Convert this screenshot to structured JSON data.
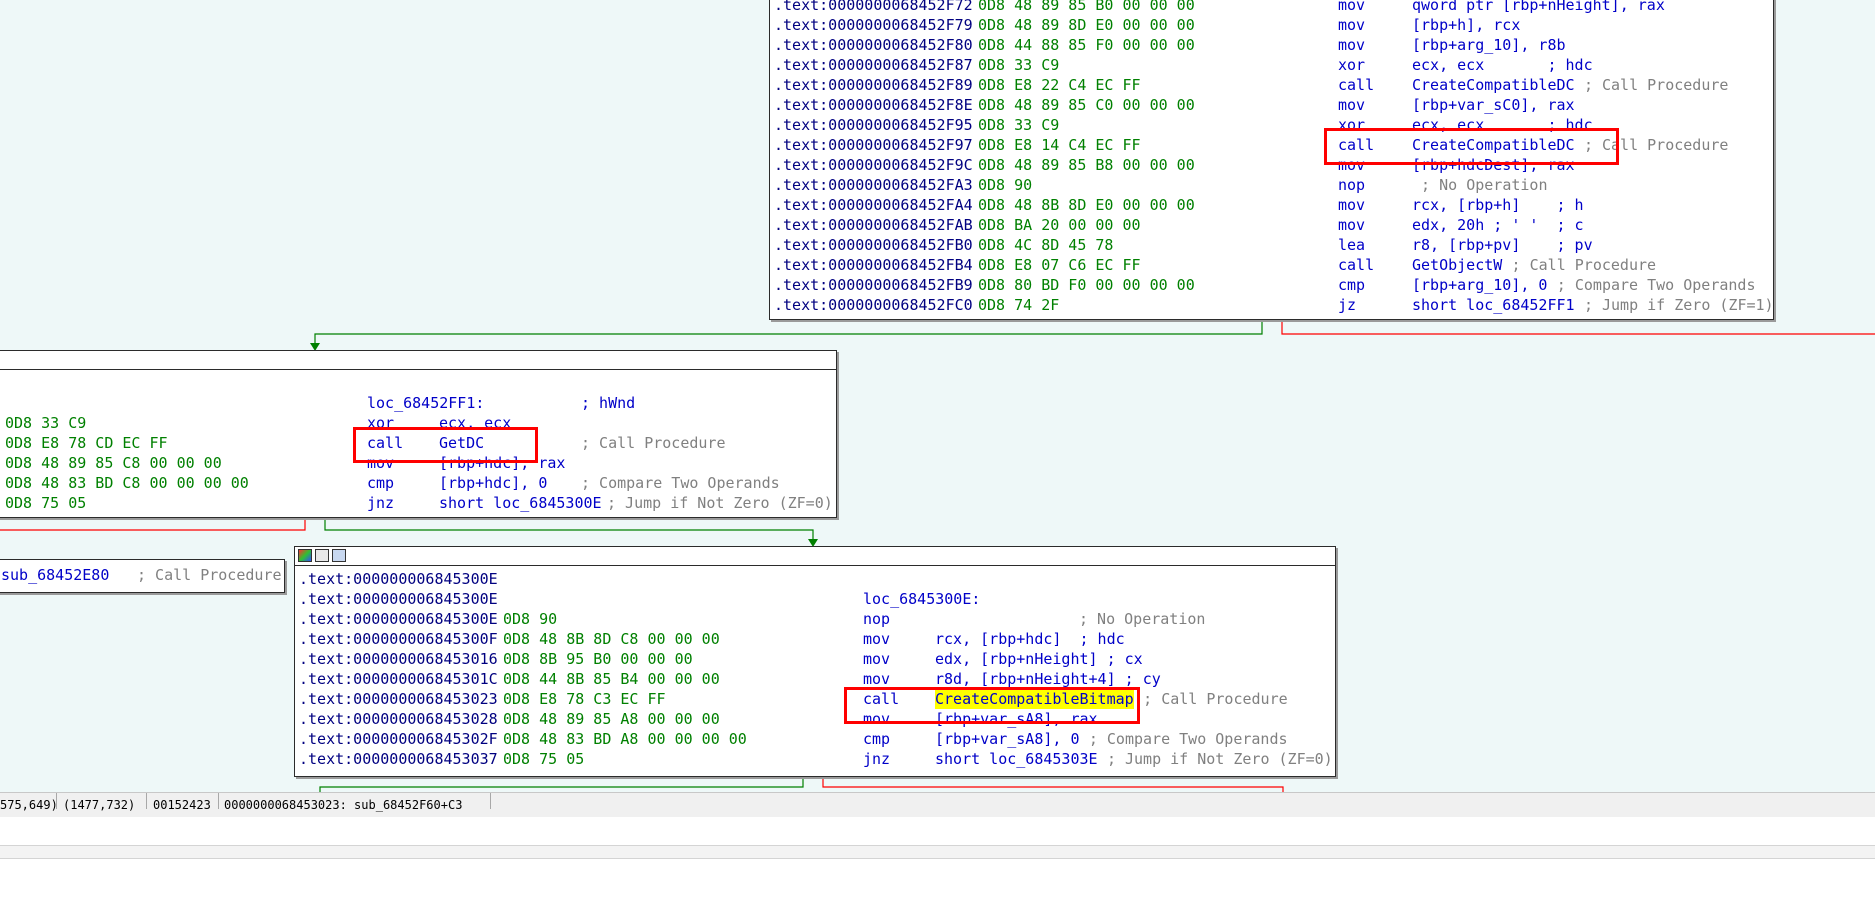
{
  "colors": {
    "accent_red": "#ff0000",
    "edge_green": "#008000",
    "edge_red": "#ff0000",
    "highlight": "#ffff00",
    "graph_bg": "#eef8f8"
  },
  "top_block": {
    "lines": [
      {
        "addr": ".text:0000000068452F72",
        "bytes": "0D8 48 89 85 B0 00 00 00",
        "mnem": "mov",
        "ops": "qword ptr [rbp+nHeight], rax",
        "cmt": ""
      },
      {
        "addr": ".text:0000000068452F79",
        "bytes": "0D8 48 89 8D E0 00 00 00",
        "mnem": "mov",
        "ops": "[rbp+h], rcx",
        "cmt": ""
      },
      {
        "addr": ".text:0000000068452F80",
        "bytes": "0D8 44 88 85 F0 00 00 00",
        "mnem": "mov",
        "ops": "[rbp+arg_10], r8b",
        "cmt": ""
      },
      {
        "addr": ".text:0000000068452F87",
        "bytes": "0D8 33 C9",
        "mnem": "xor",
        "ops": "ecx, ecx       ; hdc",
        "cmt": ""
      },
      {
        "addr": ".text:0000000068452F89",
        "bytes": "0D8 E8 22 C4 EC FF",
        "mnem": "call",
        "ops": "CreateCompatibleDC",
        "cmt": "; Call Procedure"
      },
      {
        "addr": ".text:0000000068452F8E",
        "bytes": "0D8 48 89 85 C0 00 00 00",
        "mnem": "mov",
        "ops": "[rbp+var_sC0], rax",
        "cmt": ""
      },
      {
        "addr": ".text:0000000068452F95",
        "bytes": "0D8 33 C9",
        "mnem": "xor",
        "ops": "ecx, ecx       ; hdc",
        "cmt": ""
      },
      {
        "addr": ".text:0000000068452F97",
        "bytes": "0D8 E8 14 C4 EC FF",
        "mnem": "call",
        "ops": "CreateCompatibleDC",
        "cmt": "; Call Procedure"
      },
      {
        "addr": ".text:0000000068452F9C",
        "bytes": "0D8 48 89 85 B8 00 00 00",
        "mnem": "mov",
        "ops": "[rbp+hdcDest], rax",
        "cmt": ""
      },
      {
        "addr": ".text:0000000068452FA3",
        "bytes": "0D8 90",
        "mnem": "nop",
        "ops": "",
        "cmt": "; No Operation"
      },
      {
        "addr": ".text:0000000068452FA4",
        "bytes": "0D8 48 8B 8D E0 00 00 00",
        "mnem": "mov",
        "ops": "rcx, [rbp+h]    ; h",
        "cmt": ""
      },
      {
        "addr": ".text:0000000068452FAB",
        "bytes": "0D8 BA 20 00 00 00",
        "mnem": "mov",
        "ops": "edx, 20h ; ' '  ; c",
        "cmt": ""
      },
      {
        "addr": ".text:0000000068452FB0",
        "bytes": "0D8 4C 8D 45 78",
        "mnem": "lea",
        "ops": "r8, [rbp+pv]    ; pv",
        "cmt": ""
      },
      {
        "addr": ".text:0000000068452FB4",
        "bytes": "0D8 E8 07 C6 EC FF",
        "mnem": "call",
        "ops": "GetObjectW",
        "cmt": "; Call Procedure"
      },
      {
        "addr": ".text:0000000068452FB9",
        "bytes": "0D8 80 BD F0 00 00 00 00",
        "mnem": "cmp",
        "ops": "[rbp+arg_10], 0",
        "cmt": "; Compare Two Operands"
      },
      {
        "addr": ".text:0000000068452FC0",
        "bytes": "0D8 74 2F",
        "mnem": "jz",
        "ops": "short loc_68452FF1",
        "cmt": "; Jump if Zero (ZF=1)"
      }
    ]
  },
  "mid_block": {
    "label": "loc_68452FF1:",
    "label_cmt": "; hWnd",
    "lines": [
      {
        "bytes": "0D8 33 C9",
        "mnem": "xor",
        "ops": "ecx, ecx",
        "cmt": ""
      },
      {
        "bytes": "0D8 E8 78 CD EC FF",
        "mnem": "call",
        "ops": "GetDC",
        "cmt": "; Call Procedure"
      },
      {
        "bytes": "0D8 48 89 85 C8 00 00 00",
        "mnem": "mov",
        "ops": "[rbp+hdc], rax",
        "cmt": ""
      },
      {
        "bytes": "0D8 48 83 BD C8 00 00 00 00",
        "mnem": "cmp",
        "ops": "[rbp+hdc], 0",
        "cmt": "; Compare Two Operands"
      },
      {
        "bytes": "0D8 75 05",
        "mnem": "jnz",
        "ops": "short loc_6845300E",
        "cmt": "; Jump if Not Zero (ZF=0)"
      }
    ]
  },
  "left_block": {
    "ops": "sub_68452E80",
    "cmt": "; Call Procedure"
  },
  "bottom_block": {
    "lines": [
      {
        "addr": ".text:000000006845300E",
        "bytes": "",
        "mnem": "",
        "ops": "",
        "cmt": ""
      },
      {
        "addr": ".text:000000006845300E",
        "bytes": "",
        "mnem": "loc_6845300E:",
        "ops": "",
        "cmt": ""
      },
      {
        "addr": ".text:000000006845300E",
        "bytes": "0D8 90",
        "mnem": "nop",
        "ops": "",
        "cmt": "; No Operation"
      },
      {
        "addr": ".text:000000006845300F",
        "bytes": "0D8 48 8B 8D C8 00 00 00",
        "mnem": "mov",
        "ops": "rcx, [rbp+hdc]  ; hdc",
        "cmt": ""
      },
      {
        "addr": ".text:0000000068453016",
        "bytes": "0D8 8B 95 B0 00 00 00",
        "mnem": "mov",
        "ops": "edx, [rbp+nHeight] ; cx",
        "cmt": ""
      },
      {
        "addr": ".text:000000006845301C",
        "bytes": "0D8 44 8B 85 B4 00 00 00",
        "mnem": "mov",
        "ops": "r8d, [rbp+nHeight+4] ; cy",
        "cmt": ""
      },
      {
        "addr": ".text:0000000068453023",
        "bytes": "0D8 E8 78 C3 EC FF",
        "mnem": "call",
        "ops": "CreateCompatibleBitmap",
        "cmt": "; Call Procedure"
      },
      {
        "addr": ".text:0000000068453028",
        "bytes": "0D8 48 89 85 A8 00 00 00",
        "mnem": "mov",
        "ops": "[rbp+var_sA8], rax",
        "cmt": ""
      },
      {
        "addr": ".text:000000006845302F",
        "bytes": "0D8 48 83 BD A8 00 00 00 00",
        "mnem": "cmp",
        "ops": "[rbp+var_sA8], 0",
        "cmt": "; Compare Two Operands"
      },
      {
        "addr": ".text:0000000068453037",
        "bytes": "0D8 75 05",
        "mnem": "jnz",
        "ops": "short loc_6845303E",
        "cmt": "; Jump if Not Zero (ZF=0)"
      }
    ]
  },
  "status": {
    "coords1": "575,649)",
    "coords2": "(1477,732)",
    "offset": "00152423",
    "location": "0000000068453023: sub_68452F60+C3"
  }
}
